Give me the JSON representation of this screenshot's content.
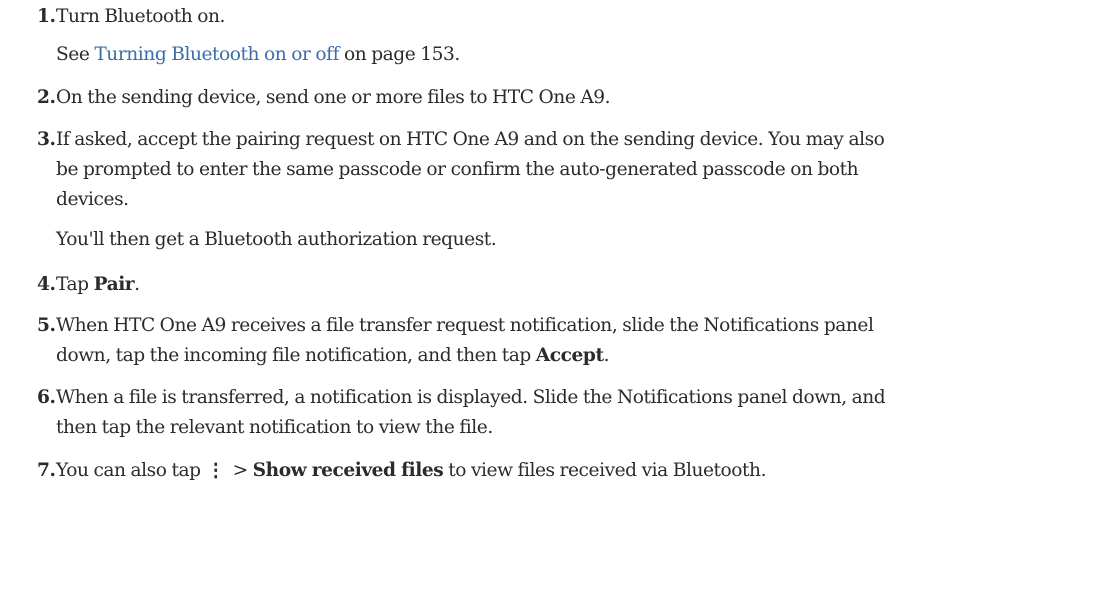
{
  "steps": [
    {
      "number": "1.",
      "text": "Turn Bluetooth on.",
      "sub": {
        "before": "See ",
        "link": "Turning Bluetooth on or off",
        "after": " on page 153."
      }
    },
    {
      "number": "2.",
      "text": "On the sending device, send one or more files to HTC One A9."
    },
    {
      "number": "3.",
      "lines": [
        "If asked, accept the pairing request on HTC One A9 and on the sending device. You may also",
        "be prompted to enter the same passcode or confirm the auto-generated passcode on both",
        "devices."
      ],
      "sub_text": "You'll then get a Bluetooth authorization request."
    },
    {
      "number": "4.",
      "before": "Tap ",
      "bold": "Pair",
      "after": "."
    },
    {
      "number": "5.",
      "line1": "When HTC One A9 receives a file transfer request notification, slide the Notifications panel",
      "line2_before": "down, tap the incoming file notification, and then tap ",
      "bold": "Accept",
      "after": "."
    },
    {
      "number": "6.",
      "lines": [
        "When a file is transferred, a notification is displayed. Slide the Notifications panel down, and",
        "then tap the relevant notification to view the file."
      ]
    },
    {
      "number": "7.",
      "before": "You can also tap",
      "icon": "more-vertical-icon",
      "icon_glyph": "⋮",
      "middle": "> ",
      "bold": "Show received files",
      "after": " to view files received via Bluetooth."
    }
  ]
}
